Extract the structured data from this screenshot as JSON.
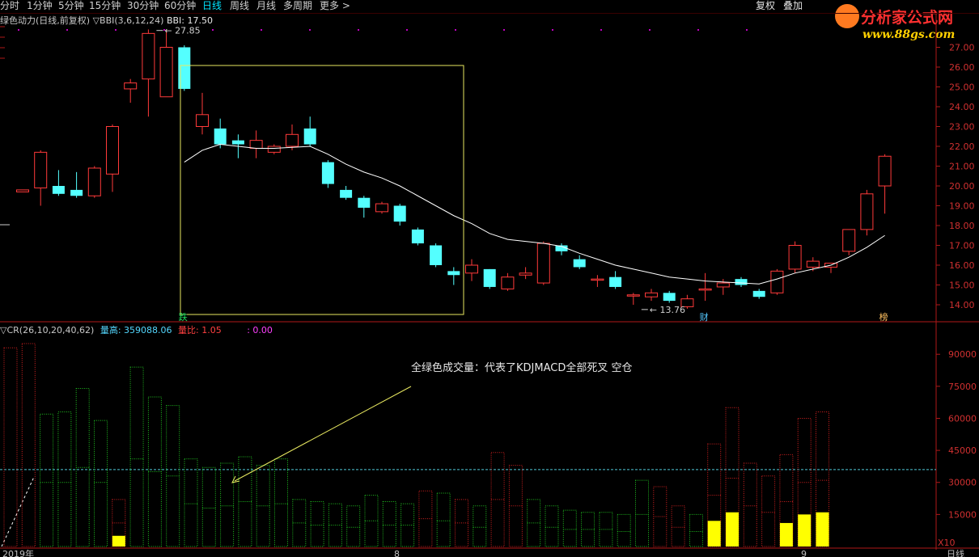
{
  "toolbar": {
    "periods": [
      "分时",
      "1分钟",
      "5分钟",
      "15分钟",
      "30分钟",
      "60分钟",
      "日线",
      "周线",
      "月线",
      "多周期",
      "更多 >"
    ],
    "active_period": "日线",
    "right_buttons": [
      "复权",
      "叠加"
    ]
  },
  "logo": {
    "line1": "分析家公式网",
    "line2": "www.88gs.com"
  },
  "indicator_top": {
    "name": "绿色动力(日线,前复权)",
    "bbi_params": "▽BBI(3,6,12,24)",
    "bbi_value_label": "BBI: 17.50"
  },
  "indicator_bottom": {
    "name": "▽CR(26,10,20,40,62)",
    "high_label": "量高: 359088.06",
    "ratio_label": "量比: 1.05",
    "extra_label": ": 0.00"
  },
  "colors": {
    "up": "#ff3a3a",
    "down": "#54ffff",
    "bbi_line": "#ffffff",
    "box": "#e8e860",
    "axis": "#b01818",
    "vol_red": "#d02020",
    "vol_green": "#20c020",
    "vol_yellow": "#ffff00"
  },
  "chart_data": [
    {
      "type": "candlestick",
      "ylim": [
        13.5,
        27.5
      ],
      "yticks": [
        "27.00",
        "26.00",
        "25.00",
        "24.00",
        "23.00",
        "22.00",
        "21.00",
        "20.00",
        "19.00",
        "18.00",
        "17.00",
        "16.00",
        "15.00",
        "14.00"
      ],
      "candles": [
        [
          19.7,
          19.8,
          19.7,
          19.8
        ],
        [
          19.9,
          21.8,
          19.0,
          21.7
        ],
        [
          20.0,
          20.8,
          19.5,
          19.6
        ],
        [
          19.8,
          20.7,
          19.4,
          19.5
        ],
        [
          19.5,
          21.0,
          19.4,
          20.9
        ],
        [
          20.6,
          23.1,
          19.7,
          23.0
        ],
        [
          24.9,
          25.4,
          24.2,
          25.2
        ],
        [
          25.4,
          27.9,
          23.5,
          27.7
        ],
        [
          24.5,
          27.9,
          24.5,
          27.0
        ],
        [
          27.0,
          27.1,
          24.8,
          24.9
        ],
        [
          23.0,
          24.7,
          22.6,
          23.6
        ],
        [
          22.9,
          23.4,
          21.9,
          22.1
        ],
        [
          22.3,
          22.6,
          21.4,
          22.1
        ],
        [
          21.9,
          22.8,
          21.4,
          22.3
        ],
        [
          21.7,
          22.1,
          21.6,
          22.0
        ],
        [
          22.0,
          23.1,
          21.8,
          22.6
        ],
        [
          22.9,
          23.5,
          22.0,
          22.1
        ],
        [
          21.2,
          21.3,
          19.9,
          20.1
        ],
        [
          19.8,
          20.0,
          19.3,
          19.4
        ],
        [
          19.4,
          19.5,
          18.4,
          18.9
        ],
        [
          18.7,
          19.2,
          18.6,
          19.1
        ],
        [
          19.0,
          19.1,
          18.0,
          18.2
        ],
        [
          17.8,
          17.9,
          17.0,
          17.1
        ],
        [
          17.0,
          17.1,
          15.9,
          16.0
        ],
        [
          15.7,
          15.9,
          15.0,
          15.5
        ],
        [
          15.6,
          16.3,
          15.2,
          16.0
        ],
        [
          15.8,
          15.8,
          14.8,
          14.9
        ],
        [
          14.8,
          15.6,
          14.7,
          15.4
        ],
        [
          15.5,
          15.9,
          15.3,
          15.6
        ],
        [
          15.1,
          17.2,
          15.0,
          17.1
        ],
        [
          17.0,
          17.1,
          16.5,
          16.7
        ],
        [
          16.3,
          16.5,
          15.8,
          15.9
        ],
        [
          15.3,
          15.5,
          14.9,
          15.3
        ],
        [
          15.4,
          15.7,
          14.8,
          14.9
        ],
        [
          14.5,
          14.6,
          14.0,
          14.5
        ],
        [
          14.4,
          14.8,
          14.2,
          14.6
        ],
        [
          14.6,
          14.7,
          14.1,
          14.2
        ],
        [
          13.9,
          14.5,
          13.8,
          14.3
        ],
        [
          14.8,
          15.6,
          14.2,
          14.8
        ],
        [
          14.9,
          15.3,
          14.5,
          15.1
        ],
        [
          15.3,
          15.4,
          14.9,
          15.0
        ],
        [
          14.7,
          14.8,
          14.3,
          14.4
        ],
        [
          14.6,
          15.8,
          14.5,
          15.7
        ],
        [
          15.8,
          17.2,
          15.6,
          17.0
        ],
        [
          15.9,
          16.4,
          15.7,
          16.2
        ],
        [
          15.9,
          16.1,
          15.6,
          16.1
        ],
        [
          16.7,
          17.8,
          16.5,
          17.8
        ],
        [
          17.8,
          19.8,
          17.5,
          19.6
        ],
        [
          20.0,
          21.6,
          18.6,
          21.5
        ]
      ],
      "bbi": [
        null,
        null,
        null,
        null,
        null,
        null,
        null,
        null,
        null,
        21.2,
        21.8,
        22.1,
        22.0,
        21.9,
        21.9,
        21.95,
        22.0,
        21.6,
        21.1,
        20.7,
        20.4,
        20.0,
        19.5,
        19.0,
        18.5,
        18.1,
        17.6,
        17.3,
        17.2,
        17.1,
        16.95,
        16.6,
        16.3,
        16.0,
        15.8,
        15.6,
        15.4,
        15.3,
        15.2,
        15.15,
        15.1,
        15.05,
        15.3,
        15.6,
        15.8,
        16.0,
        16.4,
        16.9,
        17.5
      ],
      "annotations": [
        {
          "label": "27.85",
          "value": 27.85,
          "index": 7
        },
        {
          "label": "13.76",
          "value": 13.76,
          "index": 34
        }
      ],
      "markers": [
        {
          "label": "跌",
          "index": 9
        },
        {
          "label": "财",
          "index": 38
        },
        {
          "label": "榜",
          "index": 48
        }
      ]
    },
    {
      "type": "bar",
      "ylim": [
        0,
        95000
      ],
      "yticks": [
        "90000",
        "75000",
        "60000",
        "45000",
        "30000",
        "15000"
      ],
      "multiplier_label": "X10",
      "reference_line": 36000,
      "bars": [
        {
          "c": "r",
          "h": 93000,
          "s": 0
        },
        {
          "c": "r",
          "h": 95000,
          "s": 0
        },
        {
          "c": "g",
          "h": 62000,
          "s": 30000
        },
        {
          "c": "g",
          "h": 63000,
          "s": 30000
        },
        {
          "c": "g",
          "h": 74000,
          "s": 37000
        },
        {
          "c": "g",
          "h": 59000,
          "s": 30000
        },
        {
          "c": "r",
          "h": 22000,
          "s": 11000,
          "y": 5000
        },
        {
          "c": "g",
          "h": 84000,
          "s": 41000
        },
        {
          "c": "g",
          "h": 70000,
          "s": 35000
        },
        {
          "c": "g",
          "h": 66000,
          "s": 33000
        },
        {
          "c": "g",
          "h": 41000,
          "s": 20000
        },
        {
          "c": "g",
          "h": 37000,
          "s": 18000
        },
        {
          "c": "g",
          "h": 39000,
          "s": 19000
        },
        {
          "c": "g",
          "h": 42000,
          "s": 21000
        },
        {
          "c": "g",
          "h": 38000,
          "s": 19000
        },
        {
          "c": "g",
          "h": 41000,
          "s": 20000
        },
        {
          "c": "g",
          "h": 22000,
          "s": 11000
        },
        {
          "c": "g",
          "h": 21000,
          "s": 10000
        },
        {
          "c": "g",
          "h": 20000,
          "s": 10000
        },
        {
          "c": "g",
          "h": 19000,
          "s": 9000
        },
        {
          "c": "g",
          "h": 24000,
          "s": 12000
        },
        {
          "c": "g",
          "h": 21000,
          "s": 10000
        },
        {
          "c": "g",
          "h": 20000,
          "s": 10000
        },
        {
          "c": "r",
          "h": 26000,
          "s": 13000
        },
        {
          "c": "g",
          "h": 25000,
          "s": 12000
        },
        {
          "c": "r",
          "h": 22000,
          "s": 11000
        },
        {
          "c": "g",
          "h": 19000,
          "s": 9000
        },
        {
          "c": "r",
          "h": 44000,
          "s": 22000
        },
        {
          "c": "r",
          "h": 38000,
          "s": 19000
        },
        {
          "c": "g",
          "h": 22000,
          "s": 11000
        },
        {
          "c": "g",
          "h": 19000,
          "s": 9000
        },
        {
          "c": "g",
          "h": 17000,
          "s": 8000
        },
        {
          "c": "g",
          "h": 16000,
          "s": 8000
        },
        {
          "c": "g",
          "h": 16000,
          "s": 8000
        },
        {
          "c": "g",
          "h": 15000,
          "s": 7000
        },
        {
          "c": "g",
          "h": 31000,
          "s": 15000
        },
        {
          "c": "r",
          "h": 28000,
          "s": 14000
        },
        {
          "c": "r",
          "h": 19000,
          "s": 9000
        },
        {
          "c": "g",
          "h": 15000,
          "s": 7000
        },
        {
          "c": "r",
          "h": 48000,
          "s": 24000,
          "y": 12000
        },
        {
          "c": "r",
          "h": 65000,
          "s": 32000,
          "y": 16000
        },
        {
          "c": "r",
          "h": 39000,
          "s": 19000
        },
        {
          "c": "r",
          "h": 33000,
          "s": 16000
        },
        {
          "c": "r",
          "h": 43000,
          "s": 21000,
          "y": 11000
        },
        {
          "c": "r",
          "h": 60000,
          "s": 30000,
          "y": 15000
        },
        {
          "c": "r",
          "h": 63000,
          "s": 31000,
          "y": 16000
        }
      ]
    }
  ],
  "annotation_text": "全绿色成交量：代表了KDJMACD全部死叉 空仓",
  "bottom_axis": {
    "left_label": "2019年",
    "mid_label1": "8",
    "mid_label2": "9",
    "right_label": "日线"
  }
}
